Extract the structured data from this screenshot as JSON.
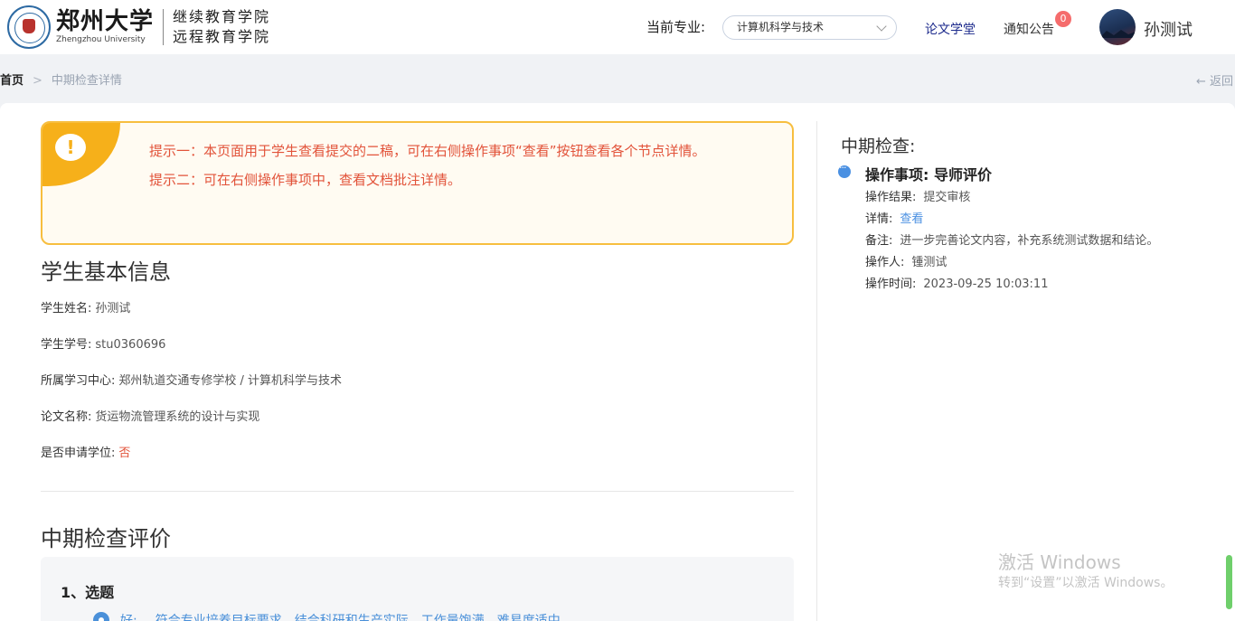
{
  "header": {
    "university_cn": "郑州大学",
    "university_en": "Zhengzhou University",
    "college_line1": "继续教育学院",
    "college_line2": "远程教育学院",
    "major_label": "当前专业:",
    "major_value": "计算机科学与技术",
    "nav_thesis": "论文学堂",
    "nav_notice": "通知公告",
    "notice_count": "0",
    "user_name": "孙测试"
  },
  "breadcrumb": {
    "home": "首页",
    "separator": ">",
    "current": "中期检查详情",
    "back": "← 返回"
  },
  "tips": {
    "line1": "提示一：本页面用于学生查看提交的二稿，可在右侧操作事项“查看”按钮查看各个节点详情。",
    "line2": "提示二：可在右侧操作事项中，查看文档批注详情。"
  },
  "basic_info": {
    "title": "学生基本信息",
    "rows": [
      {
        "label": "学生姓名:",
        "value": "孙测试"
      },
      {
        "label": "学生学号:",
        "value": "stu0360696"
      },
      {
        "label": "所属学习中心:",
        "value": "郑州轨道交通专修学校 / 计算机科学与技术"
      },
      {
        "label": "论文名称:",
        "value": "货运物流管理系统的设计与实现"
      },
      {
        "label": "是否申请学位:",
        "value": "否"
      }
    ]
  },
  "evaluation": {
    "title": "中期检查评价",
    "question": "1、选题",
    "option_label": "好:",
    "option_text": "符合专业培养目标要求，结合科研和生产实际，工作量饱满，难易度适中"
  },
  "right_panel": {
    "title": "中期检查:",
    "op_item_label": "操作事项:",
    "op_item_value": "导师评价",
    "rows": [
      {
        "label": "操作结果:",
        "value": "提交审核"
      },
      {
        "label": "详情:",
        "value": "查看"
      },
      {
        "label": "备注:",
        "value": "进一步完善论文内容，补充系统测试数据和结论。"
      },
      {
        "label": "操作人:",
        "value": "锺测试"
      },
      {
        "label": "操作时间:",
        "value": "2023-09-25 10:03:11"
      }
    ]
  },
  "watermark": {
    "line1": "激活 Windows",
    "line2": "转到“设置”以激活 Windows。"
  },
  "colors": {
    "accent_blue": "#4a90e2",
    "tip_orange": "#f6b01a",
    "tip_text": "#e2533a",
    "badge_red": "#f56c6c"
  }
}
